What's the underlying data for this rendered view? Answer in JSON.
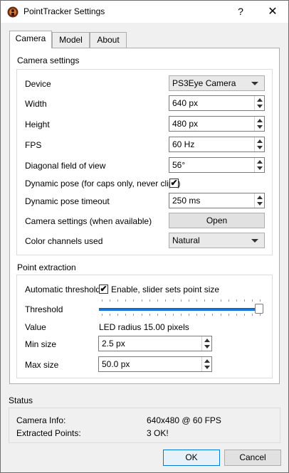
{
  "window": {
    "title": "PointTracker Settings",
    "help": "?",
    "close": "✕"
  },
  "tabs": [
    {
      "label": "Camera"
    },
    {
      "label": "Model"
    },
    {
      "label": "About"
    }
  ],
  "camera_settings": {
    "group_title": "Camera settings",
    "device": {
      "label": "Device",
      "value": "PS3Eye Camera"
    },
    "width": {
      "label": "Width",
      "value": "640 px"
    },
    "height": {
      "label": "Height",
      "value": "480 px"
    },
    "fps": {
      "label": "FPS",
      "value": "60 Hz"
    },
    "fov": {
      "label": "Diagonal field of view",
      "value": "56°"
    },
    "dynamic_pose": {
      "label": "Dynamic pose (for caps only, never clips)",
      "checked": "✔"
    },
    "dynamic_pose_timeout": {
      "label": "Dynamic pose timeout",
      "value": "250 ms"
    },
    "camera_settings_open": {
      "label": "Camera settings (when available)",
      "button": "Open"
    },
    "color_channels": {
      "label": "Color channels used",
      "value": "Natural"
    }
  },
  "point_extraction": {
    "group_title": "Point extraction",
    "auto_threshold": {
      "label": "Automatic threshold",
      "checked": "✔",
      "checkbox_text": "Enable, slider sets point size"
    },
    "threshold": {
      "label": "Threshold",
      "level": 1.0
    },
    "value": {
      "label": "Value",
      "text": "LED radius 15.00 pixels"
    },
    "min_size": {
      "label": "Min size",
      "value": "2.5 px"
    },
    "max_size": {
      "label": "Max size",
      "value": "50.0 px"
    }
  },
  "status": {
    "group_title": "Status",
    "camera_info": {
      "label": "Camera Info:",
      "value": "640x480 @ 60 FPS"
    },
    "extracted_points": {
      "label": "Extracted Points:",
      "value": "3 OK!"
    }
  },
  "buttons": {
    "ok": "OK",
    "cancel": "Cancel"
  },
  "colors": {
    "accent": "#1976d2",
    "default_button_border": "#0078d7"
  }
}
